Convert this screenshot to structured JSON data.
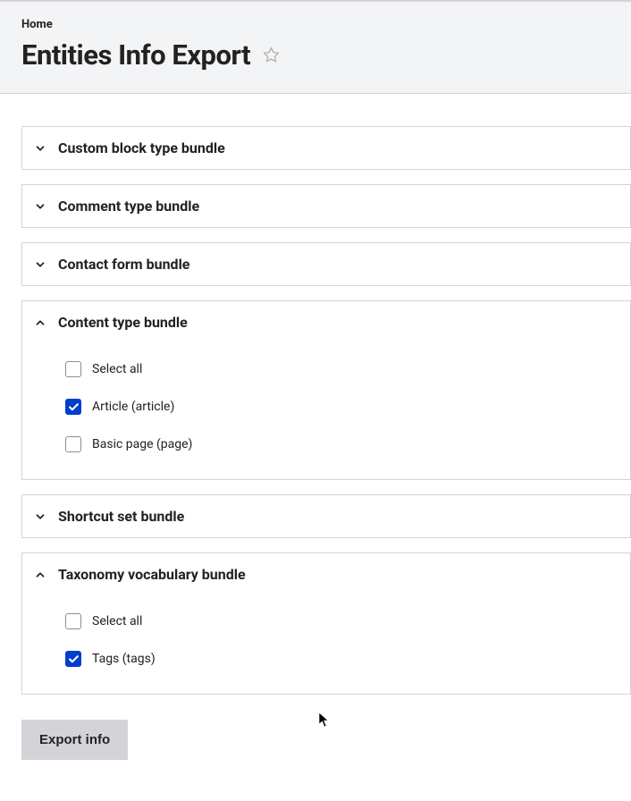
{
  "breadcrumb": {
    "home": "Home"
  },
  "page_title": "Entities Info Export",
  "bundles": [
    {
      "label": "Custom block type bundle"
    },
    {
      "label": "Comment type bundle"
    },
    {
      "label": "Contact form bundle"
    },
    {
      "label": "Content type bundle"
    },
    {
      "label": "Shortcut set bundle"
    },
    {
      "label": "Taxonomy vocabulary bundle"
    }
  ],
  "content_type": {
    "select_all": "Select all",
    "options": [
      {
        "label": "Article (article)"
      },
      {
        "label": "Basic page (page)"
      }
    ]
  },
  "taxonomy": {
    "select_all": "Select all",
    "options": [
      {
        "label": "Tags (tags)"
      }
    ]
  },
  "actions": {
    "export": "Export info"
  }
}
